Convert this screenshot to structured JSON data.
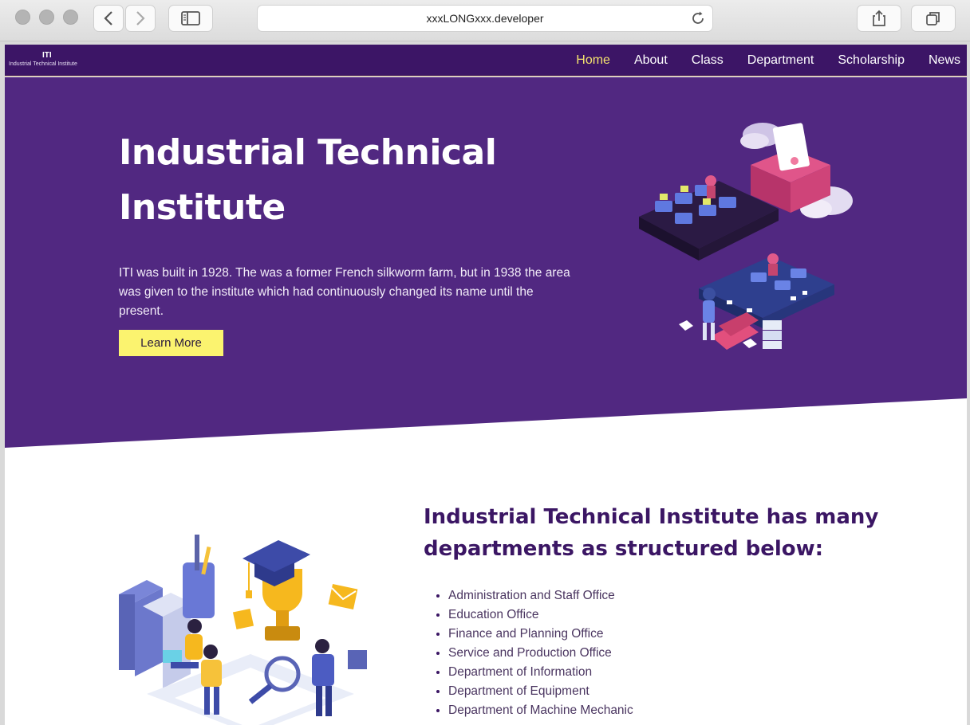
{
  "browser": {
    "url": "xxxLONGxxx.developer"
  },
  "navbar": {
    "brand_title": "ITI",
    "brand_subtitle": "Industrial Technical Institute",
    "links": [
      "Home",
      "About",
      "Class",
      "Department",
      "Scholarship",
      "News"
    ],
    "active_link": "Home"
  },
  "hero": {
    "title_line1": "Industrial Technical",
    "title_line2": "Institute",
    "description": "ITI was built in 1928. The was a former French silkworm farm, but in 1938 the area was given to the institute which had continuously changed its name until the present.",
    "button_label": "Learn More"
  },
  "departments": {
    "heading": "Industrial Technical Institute has many departments as structured below:",
    "items": [
      "Administration and Staff Office",
      "Education Office",
      "Finance and Planning Office",
      "Service and Production Office",
      "Department of Information",
      "Department of Equipment",
      "Department of Machine Mechanic"
    ]
  },
  "colors": {
    "navbar": "#3c1566",
    "hero": "#512881",
    "accent_yellow": "#fbf36f",
    "heading": "#3b1664"
  }
}
